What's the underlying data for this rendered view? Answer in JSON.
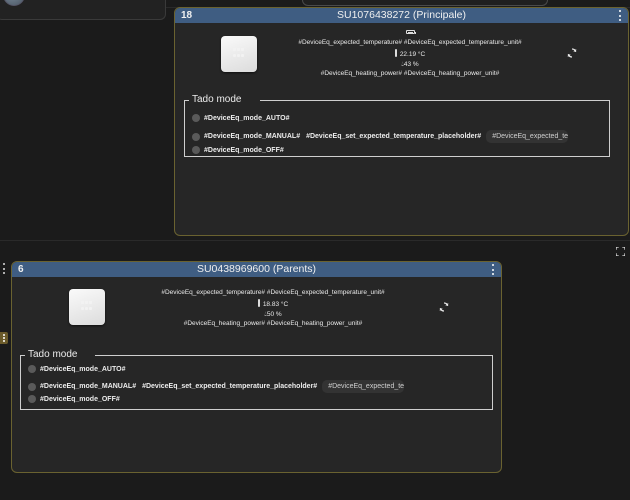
{
  "cards": [
    {
      "id": "18",
      "title": "SU1076438272 (Principale)",
      "expected_temperature_line": "#DeviceEq_expected_temperature# #DeviceEq_expected_temperature_unit#",
      "current_temperature": "22.19 °C",
      "humidity": "43 %",
      "heating_power_line": "#DeviceEq_heating_power# #DeviceEq_heating_power_unit#",
      "mode_legend": "Tado mode",
      "modes": {
        "auto": "#DeviceEq_mode_AUTO#",
        "manual": "#DeviceEq_mode_MANUAL#",
        "set_placeholder": "#DeviceEq_set_expected_temperature_placeholder#",
        "expected_input": "#DeviceEq_expected_te",
        "off": "#DeviceEq_mode_OFF#"
      }
    },
    {
      "id": "6",
      "title": "SU0438969600 (Parents)",
      "expected_temperature_line": "#DeviceEq_expected_temperature# #DeviceEq_expected_temperature_unit#",
      "current_temperature": "18.83 °C",
      "humidity": "50 %",
      "heating_power_line": "#DeviceEq_heating_power# #DeviceEq_heating_power_unit#",
      "mode_legend": "Tado mode",
      "modes": {
        "auto": "#DeviceEq_mode_AUTO#",
        "manual": "#DeviceEq_mode_MANUAL#",
        "set_placeholder": "#DeviceEq_set_expected_temperature_placeholder#",
        "expected_input": "#DeviceEq_expected_te",
        "off": "#DeviceEq_mode_OFF#"
      }
    }
  ],
  "colors": {
    "header_bar": "#3f5d82",
    "card_border": "#6a6230",
    "background": "#1b1b1b"
  },
  "icons": [
    "kebab-menu-icon",
    "thermostat-icon",
    "battery-icon",
    "thermometer-icon",
    "humidity-icon",
    "refresh-icon",
    "expand-icon"
  ]
}
